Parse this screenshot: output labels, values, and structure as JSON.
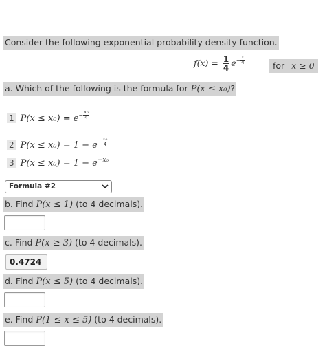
{
  "intro": "Consider the following exponential probability density function.",
  "pdf": {
    "lhs": "f(x) = ",
    "coef_num": "1",
    "coef_den": "4",
    "exp_num": "x",
    "exp_den": "4",
    "for": "for",
    "cond": "x ≥ 0"
  },
  "part_a": {
    "prefix": "a. Which of the following is the formula for ",
    "expr": "P(x ≤ x₀)",
    "suffix": "?",
    "options": [
      {
        "num": "1",
        "lhs": "P(x ≤ x₀) = e",
        "exp_num": "x₀",
        "exp_den": "4"
      },
      {
        "num": "2",
        "lhs": "P(x ≤ x₀) = 1 − e",
        "exp_num": "x₀",
        "exp_den": "4"
      },
      {
        "num": "3",
        "lhs": "P(x ≤ x₀) = 1 − e",
        "exp_plain": "−x₀"
      }
    ],
    "select_value": "Formula #2"
  },
  "part_b": {
    "prefix": "b. Find ",
    "expr": "P(x ≤ 1)",
    "suffix": " (to 4 decimals).",
    "answer": ""
  },
  "part_c": {
    "prefix": "c. Find ",
    "expr": "P(x ≥ 3)",
    "suffix": " (to 4 decimals).",
    "answer": "0.4724"
  },
  "part_d": {
    "prefix": "d. Find ",
    "expr": "P(x ≤ 5)",
    "suffix": " (to 4 decimals).",
    "answer": ""
  },
  "part_e": {
    "prefix": "e. Find ",
    "expr": "P(1 ≤ x ≤ 5)",
    "suffix": " (to 4 decimals).",
    "answer": ""
  }
}
